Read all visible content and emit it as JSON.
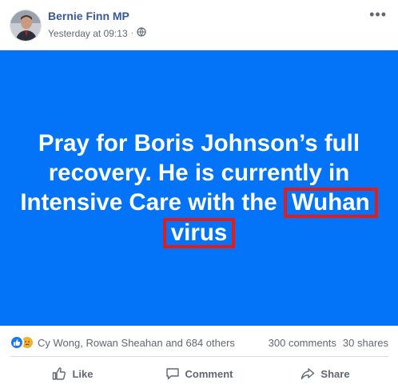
{
  "post": {
    "author": "Bernie Finn MP",
    "timestamp": "Yesterday at 09:13",
    "privacy_icon": "globe-icon",
    "more_icon": "more-options-icon"
  },
  "status": {
    "background_color": "#0374f7",
    "highlight_color": "#e21b1b",
    "line1": "Pray for Boris Johnson’s full",
    "line2": "recovery. He is currently in",
    "line3_prefix": "Intensive Care with the ",
    "highlight1": "Wuhan",
    "highlight2": "virus"
  },
  "engagement": {
    "reaction_icons": [
      "like-reaction-icon",
      "sad-reaction-icon"
    ],
    "reactors": "Cy Wong, Rowan Sheahan and 684 others",
    "comments": "300 comments",
    "shares": "30 shares"
  },
  "actions": {
    "like": "Like",
    "comment": "Comment",
    "share": "Share"
  }
}
